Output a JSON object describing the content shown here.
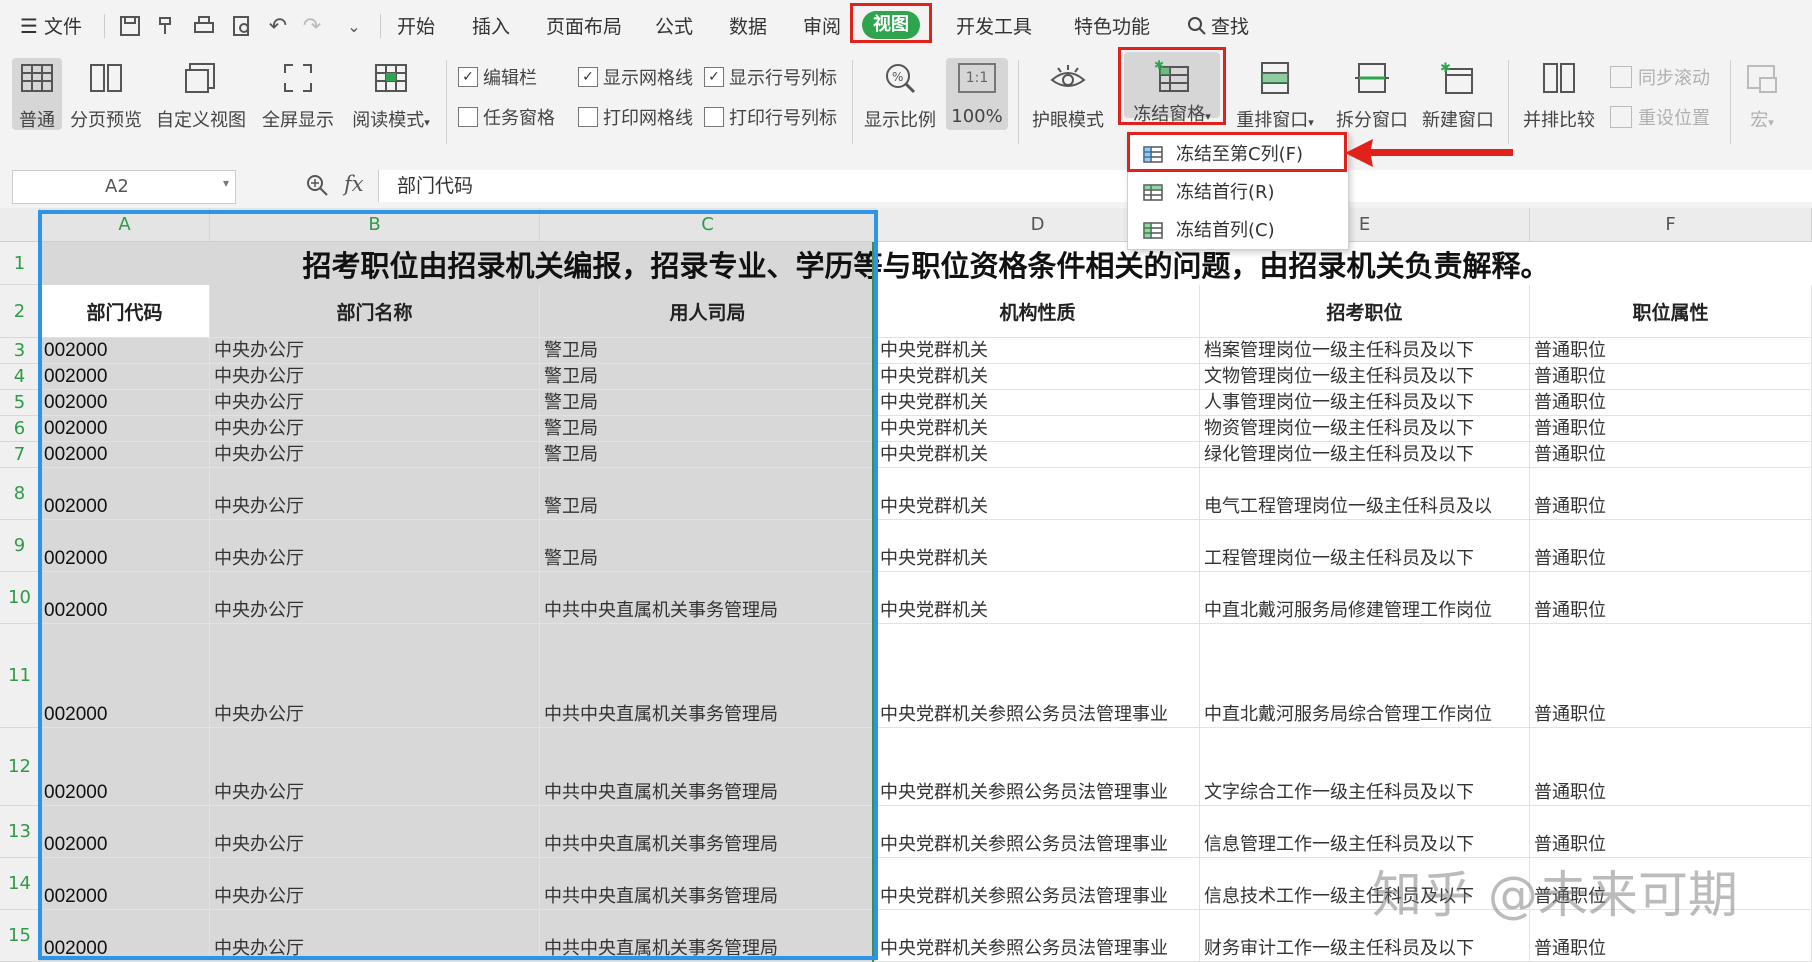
{
  "menubar": {
    "file_label": "文件",
    "tabs": [
      "开始",
      "插入",
      "页面布局",
      "公式",
      "数据",
      "审阅",
      "视图",
      "开发工具",
      "特色功能"
    ],
    "active_tab": "视图",
    "search_label": "查找"
  },
  "ribbon": {
    "normal": "普通",
    "page_break_preview": "分页预览",
    "custom_view": "自定义视图",
    "full_screen": "全屏显示",
    "reading_mode": "阅读模式",
    "edit_bar": "编辑栏",
    "task_pane": "任务窗格",
    "show_gridlines": "显示网格线",
    "print_gridlines": "打印网格线",
    "show_headings": "显示行号列标",
    "print_headings": "打印行号列标",
    "zoom": "显示比例",
    "zoom_100": "100%",
    "zoom_100_icon": "1:1",
    "eye_care": "护眼模式",
    "freeze_panes": "冻结窗格",
    "arrange_all": "重排窗口",
    "split_window": "拆分窗口",
    "new_window": "新建窗口",
    "side_by_side": "并排比较",
    "sync_scroll": "同步滚动",
    "reset_position": "重设位置",
    "macro": "宏"
  },
  "freeze_menu": {
    "items": [
      "冻结至第C列(F)",
      "冻结首行(R)",
      "冻结首列(C)"
    ]
  },
  "formula_bar": {
    "cell_ref": "A2",
    "fx": "fx",
    "content": "部门代码"
  },
  "sheet": {
    "columns": [
      "A",
      "B",
      "C",
      "D",
      "E",
      "F"
    ],
    "row_numbers": [
      "1",
      "2",
      "3",
      "4",
      "5",
      "6",
      "7",
      "8",
      "9",
      "10",
      "11",
      "12",
      "13",
      "14",
      "15"
    ],
    "title": "招考职位由招录机关编报，招录专业、学历等与职位资格条件相关的问题，由招录机关负责解释。",
    "headers": [
      "部门代码",
      "部门名称",
      "用人司局",
      "机构性质",
      "招考职位",
      "职位属性"
    ],
    "rows": [
      [
        "002000",
        "中央办公厅",
        "警卫局",
        "中央党群机关",
        "档案管理岗位一级主任科员及以下",
        "普通职位"
      ],
      [
        "002000",
        "中央办公厅",
        "警卫局",
        "中央党群机关",
        "文物管理岗位一级主任科员及以下",
        "普通职位"
      ],
      [
        "002000",
        "中央办公厅",
        "警卫局",
        "中央党群机关",
        "人事管理岗位一级主任科员及以下",
        "普通职位"
      ],
      [
        "002000",
        "中央办公厅",
        "警卫局",
        "中央党群机关",
        "物资管理岗位一级主任科员及以下",
        "普通职位"
      ],
      [
        "002000",
        "中央办公厅",
        "警卫局",
        "中央党群机关",
        "绿化管理岗位一级主任科员及以下",
        "普通职位"
      ],
      [
        "002000",
        "中央办公厅",
        "警卫局",
        "中央党群机关",
        "电气工程管理岗位一级主任科员及以",
        "普通职位"
      ],
      [
        "002000",
        "中央办公厅",
        "警卫局",
        "中央党群机关",
        "工程管理岗位一级主任科员及以下",
        "普通职位"
      ],
      [
        "002000",
        "中央办公厅",
        "中共中央直属机关事务管理局",
        "中央党群机关",
        "中直北戴河服务局修建管理工作岗位",
        "普通职位"
      ],
      [
        "002000",
        "中央办公厅",
        "中共中央直属机关事务管理局",
        "中央党群机关参照公务员法管理事业",
        "中直北戴河服务局综合管理工作岗位",
        "普通职位"
      ],
      [
        "002000",
        "中央办公厅",
        "中共中央直属机关事务管理局",
        "中央党群机关参照公务员法管理事业",
        "文字综合工作一级主任科员及以下",
        "普通职位"
      ],
      [
        "002000",
        "中央办公厅",
        "中共中央直属机关事务管理局",
        "中央党群机关参照公务员法管理事业",
        "信息管理工作一级主任科员及以下",
        "普通职位"
      ],
      [
        "002000",
        "中央办公厅",
        "中共中央直属机关事务管理局",
        "中央党群机关参照公务员法管理事业",
        "信息技术工作一级主任科员及以下",
        "普通职位"
      ],
      [
        "002000",
        "中央办公厅",
        "中共中央直属机关事务管理局",
        "中央党群机关参照公务员法管理事业",
        "财务审计工作一级主任科员及以下",
        "普通职位"
      ]
    ]
  },
  "watermark": "知乎 @未来可期",
  "colors": {
    "highlight_red": "#e0221c",
    "selection_blue": "#2e94e8",
    "active_tab_green": "#2ea44f",
    "row_header_green": "#2e9b47"
  }
}
